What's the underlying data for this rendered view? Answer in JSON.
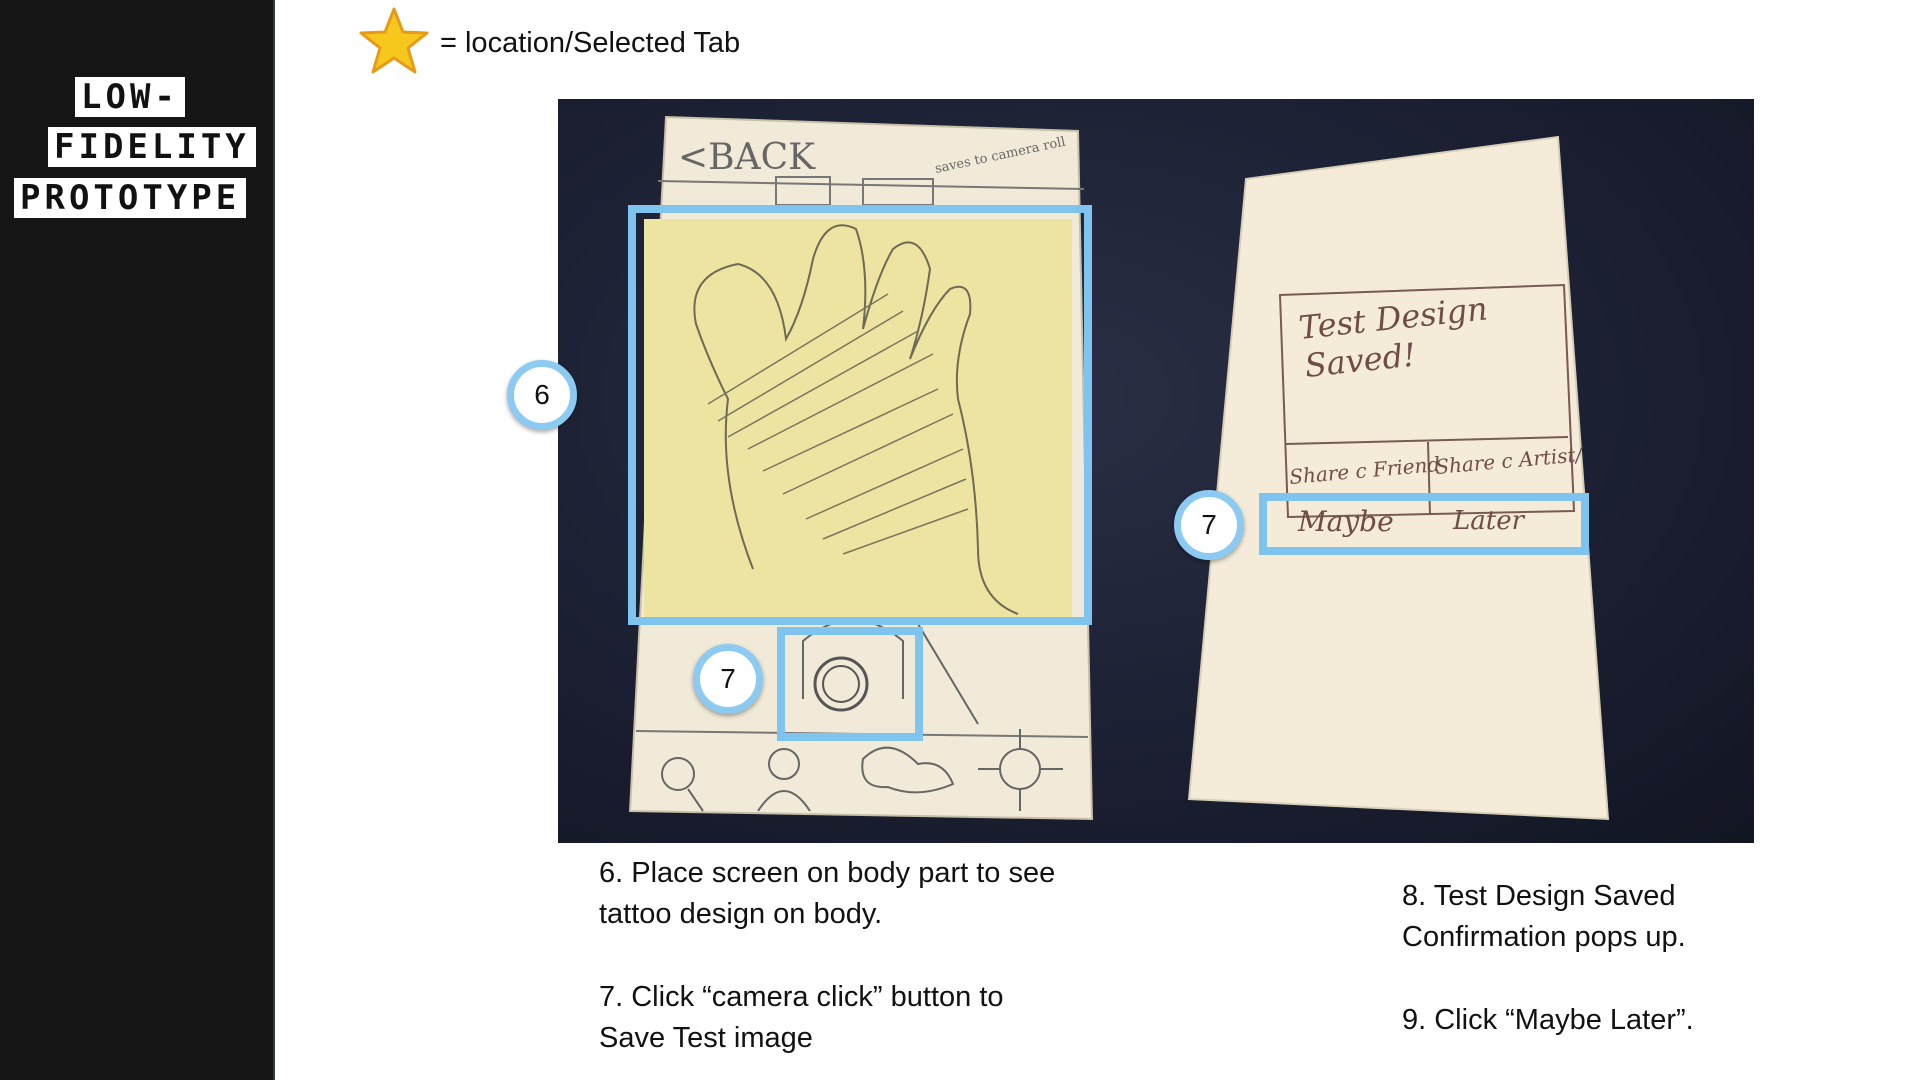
{
  "sidebar": {
    "title_lines": [
      "LOW-",
      "FIDELITY",
      "PROTOTYPE"
    ]
  },
  "legend": {
    "icon": "star-icon",
    "text": "= location/Selected Tab"
  },
  "sketch_left": {
    "back_label": "<BACK",
    "corner_note": "saves to camera roll"
  },
  "sketch_right": {
    "dialog_title_lines": [
      "Test Design",
      "Saved!"
    ],
    "button_share_friend": "Share c Friend",
    "button_share_artist": "Share c Artist/",
    "button_maybe": "Maybe",
    "button_later": "Later"
  },
  "badges": {
    "screen": "6",
    "camera": "7",
    "maybe": "7"
  },
  "captions": {
    "step6": [
      "6.  Place screen on body part to see",
      "tattoo design on body."
    ],
    "step7": [
      "7.  Click “camera click”  button to",
      "Save Test image"
    ],
    "step8": [
      "8. Test Design Saved",
      "Confirmation pops up."
    ],
    "step9": [
      "9. Click “Maybe Later”."
    ]
  },
  "colors": {
    "sidebar_bg": "#161616",
    "highlight": "#7fc4ef",
    "star": "#f6c71c",
    "sticky_note": "#ece4a0",
    "paper": "#f4ecd9",
    "photo_bg": "#1c2033"
  }
}
